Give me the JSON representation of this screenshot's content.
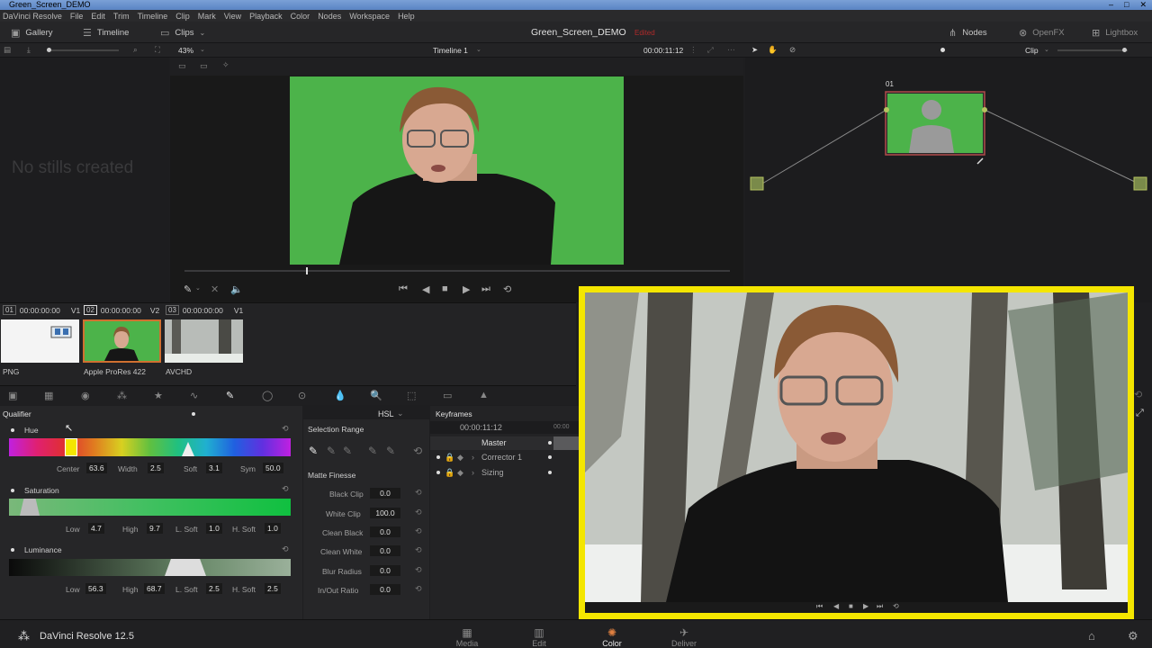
{
  "titlebar": {
    "title": "Green_Screen_DEMO"
  },
  "menu": [
    "DaVinci Resolve",
    "File",
    "Edit",
    "Trim",
    "Timeline",
    "Clip",
    "Mark",
    "View",
    "Playback",
    "Color",
    "Nodes",
    "Workspace",
    "Help"
  ],
  "toolbar": {
    "gallery": "Gallery",
    "timeline": "Timeline",
    "clips": "Clips",
    "project": "Green_Screen_DEMO",
    "edited": "Edited",
    "nodes": "Nodes",
    "openfx": "OpenFX",
    "lightbox": "Lightbox"
  },
  "subbar": {
    "zoom": "43%",
    "timeline_name": "Timeline 1",
    "timecode": "00:00:11:12",
    "clip_mode": "Clip"
  },
  "gallery": {
    "empty_text": "No stills created"
  },
  "nodes": {
    "node_label": "01"
  },
  "clips": [
    {
      "num": "01",
      "tc": "00:00:00:00",
      "track": "V1",
      "name": "PNG"
    },
    {
      "num": "02",
      "tc": "00:00:00:00",
      "track": "V2",
      "name": "Apple ProRes 422"
    },
    {
      "num": "03",
      "tc": "00:00:00:00",
      "track": "V1",
      "name": "AVCHD"
    }
  ],
  "qualifier": {
    "title": "Qualifier",
    "mode": "HSL",
    "hue": {
      "label": "Hue",
      "center_label": "Center",
      "center": "63.6",
      "width_label": "Width",
      "width": "2.5",
      "soft_label": "Soft",
      "soft": "3.1",
      "sym_label": "Sym",
      "sym": "50.0"
    },
    "saturation": {
      "label": "Saturation",
      "low_label": "Low",
      "low": "4.7",
      "high_label": "High",
      "high": "9.7",
      "lsoft_label": "L. Soft",
      "lsoft": "1.0",
      "hsoft_label": "H. Soft",
      "hsoft": "1.0"
    },
    "luminance": {
      "label": "Luminance",
      "low_label": "Low",
      "low": "56.3",
      "high_label": "High",
      "high": "68.7",
      "lsoft_label": "L. Soft",
      "lsoft": "2.5",
      "hsoft_label": "H. Soft",
      "hsoft": "2.5"
    }
  },
  "selection": {
    "title": "Selection Range",
    "matte_title": "Matte Finesse",
    "rows": [
      {
        "label": "Black Clip",
        "value": "0.0"
      },
      {
        "label": "White Clip",
        "value": "100.0"
      },
      {
        "label": "Clean Black",
        "value": "0.0"
      },
      {
        "label": "Clean White",
        "value": "0.0"
      },
      {
        "label": "Blur Radius",
        "value": "0.0"
      },
      {
        "label": "In/Out Ratio",
        "value": "0.0"
      }
    ]
  },
  "keyframes": {
    "title": "Keyframes",
    "timecode": "00:00:11:12",
    "tc_short": "00:00",
    "rows": [
      "Master",
      "Corrector 1",
      "Sizing"
    ]
  },
  "pages": [
    "Media",
    "Edit",
    "Color",
    "Deliver"
  ],
  "app_name": "DaVinci Resolve 12.5",
  "colors": {
    "accent_yellow": "#f4e600",
    "green_screen": "#4ab04a",
    "edited_red": "#b02a2a"
  }
}
